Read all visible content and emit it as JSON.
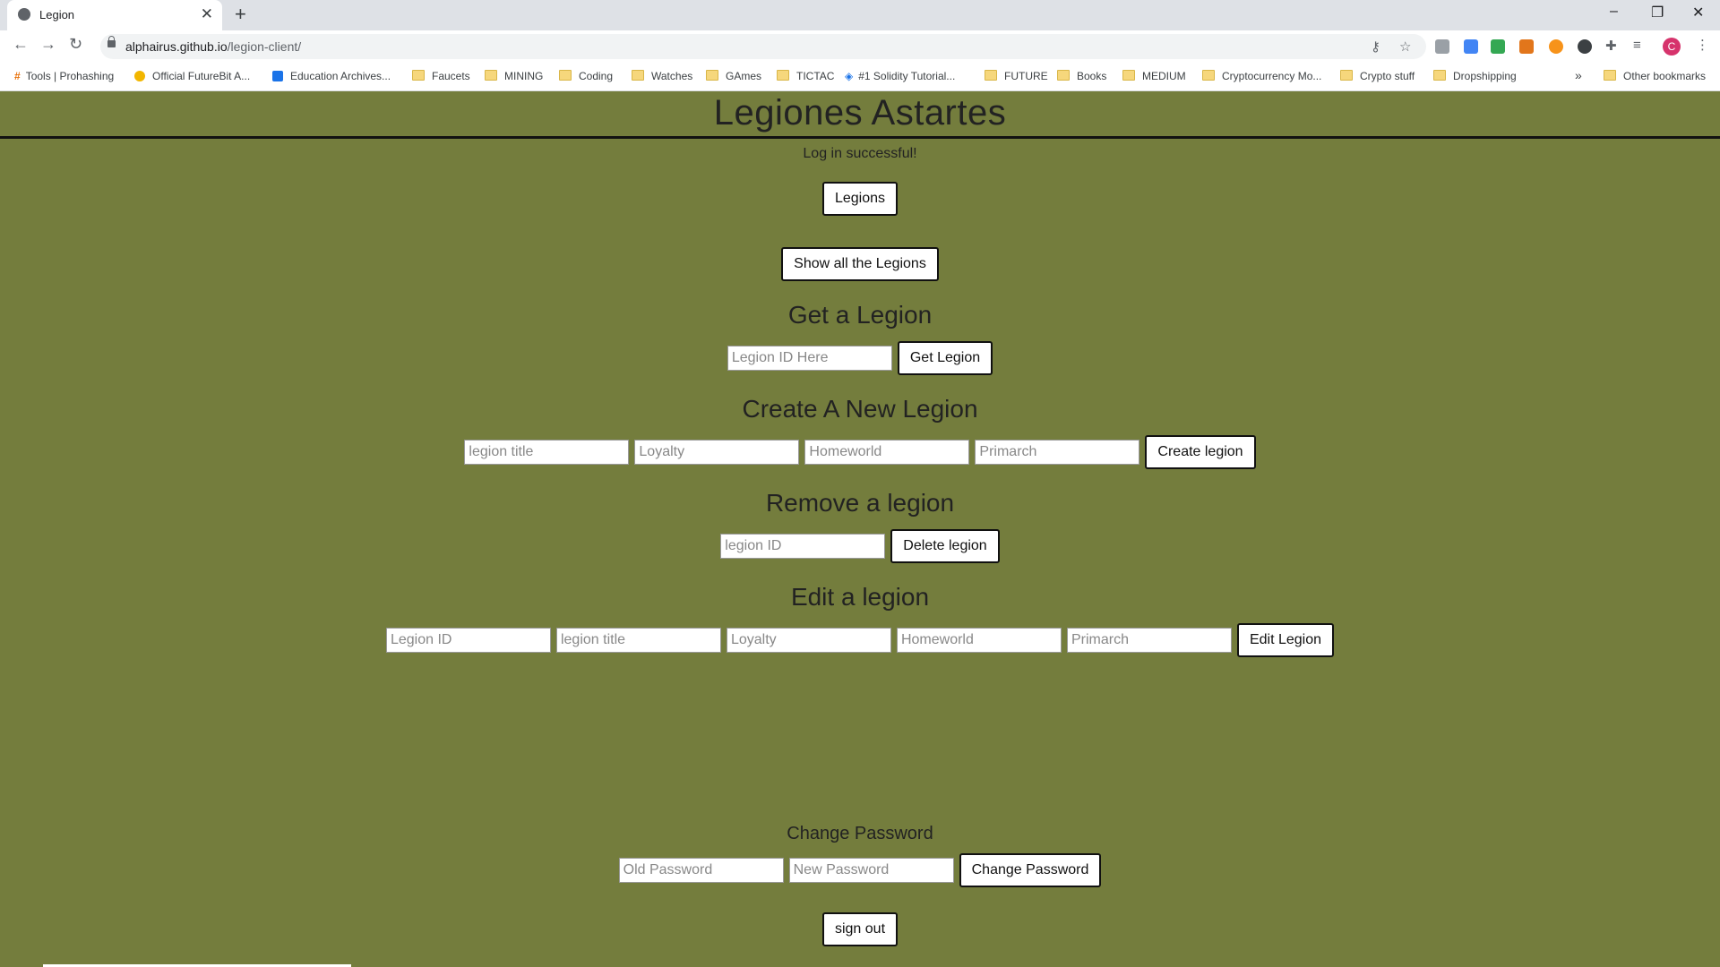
{
  "browser": {
    "tab_title": "Legion",
    "url_host": "alphairus.github.io",
    "url_path": "/legion-client/",
    "bookmarks": [
      "Tools | Prohashing",
      "Official FutureBit A...",
      "Education Archives...",
      "Faucets",
      "MINING",
      "Coding",
      "Watches",
      "GAmes",
      "TICTAC",
      "#1 Solidity Tutorial...",
      "FUTURE",
      "Books",
      "MEDIUM",
      "Cryptocurrency Mo...",
      "Crypto stuff",
      "Dropshipping"
    ],
    "other_bookmarks": "Other bookmarks",
    "more_bookmarks": "»",
    "avatar_letter": "C"
  },
  "page": {
    "title": "Legiones Astartes",
    "message": "Log in successful!",
    "legions_button": "Legions",
    "show_all_button": "Show all the Legions",
    "get": {
      "heading": "Get a Legion",
      "id_placeholder": "Legion ID Here",
      "button": "Get Legion"
    },
    "create": {
      "heading": "Create A New Legion",
      "title_placeholder": "legion title",
      "loyalty_placeholder": "Loyalty",
      "homeworld_placeholder": "Homeworld",
      "primarch_placeholder": "Primarch",
      "button": "Create legion"
    },
    "remove": {
      "heading": "Remove a legion",
      "id_placeholder": "legion ID",
      "button": "Delete legion"
    },
    "edit": {
      "heading": "Edit a legion",
      "id_placeholder": "Legion ID",
      "title_placeholder": "legion title",
      "loyalty_placeholder": "Loyalty",
      "homeworld_placeholder": "Homeworld",
      "primarch_placeholder": "Primarch",
      "button": "Edit Legion"
    },
    "password": {
      "heading": "Change Password",
      "old_placeholder": "Old Password",
      "new_placeholder": "New Password",
      "button": "Change Password"
    },
    "signout_button": "sign out"
  },
  "colors": {
    "page_background": "#747d3d"
  }
}
